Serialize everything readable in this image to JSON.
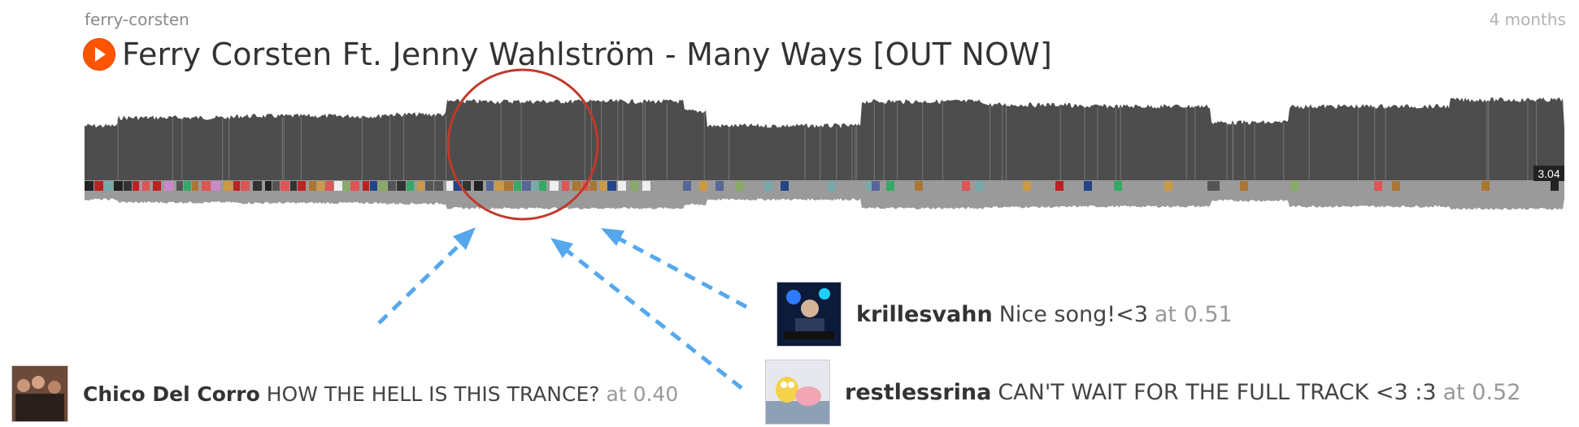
{
  "track": {
    "username": "ferry-corsten",
    "time_ago": "4 months",
    "title": "Ferry Corsten Ft. Jenny Wahlström - Many Ways [OUT NOW]",
    "playhead_time": "3.04"
  },
  "comments": [
    {
      "user": "krillesvahn",
      "text": "Nice song!<3",
      "at": "at 0.51",
      "avatar": "dj-stage-avatar"
    },
    {
      "user": "Chico Del Corro",
      "text": "HOW THE HELL IS THIS TRANCE?",
      "at": "at 0.40",
      "avatar": "group-photo-avatar"
    },
    {
      "user": "restlessrina",
      "text": "CAN'T WAIT FOR THE FULL TRACK <3 :3",
      "at": "at 0.52",
      "avatar": "spongebob-avatar"
    }
  ],
  "colors": {
    "waveform_top": "#4d4d4d",
    "waveform_bottom": "#9a9a9a",
    "highlight_circle": "#c0392b",
    "arrows": "#55a8ee",
    "play_button": "#ff5500"
  },
  "icons": [
    "play-icon",
    "comment-avatar-strip"
  ]
}
